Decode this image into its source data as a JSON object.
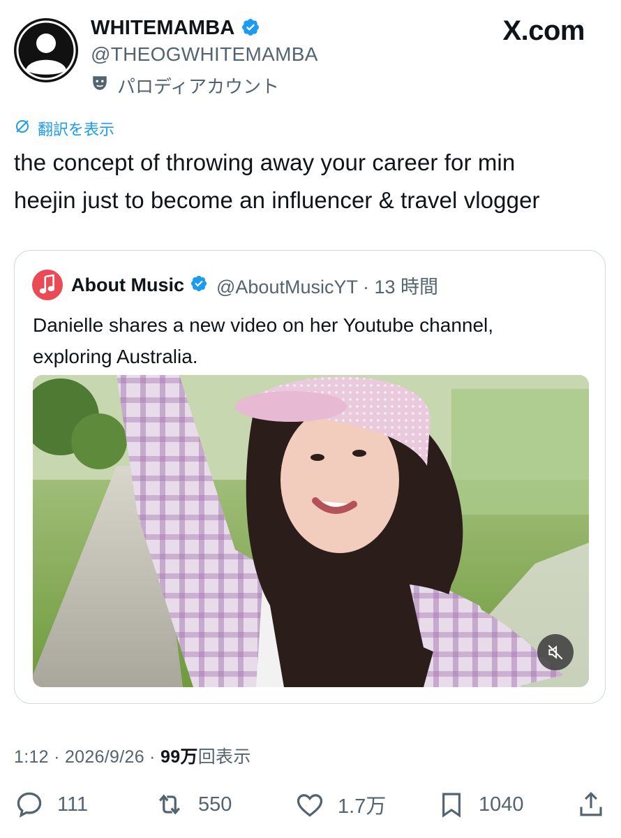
{
  "header": {
    "display_name": "WHITEMAMBA",
    "handle": "@THEOGWHITEMAMBA",
    "parody_label": "パロディアカウント",
    "site_label": "X.com"
  },
  "translate_label": "翻訳を表示",
  "tweet": {
    "line1": "the concept of throwing away your career for min",
    "line2": "heejin just to become an influencer & travel vlogger"
  },
  "quote": {
    "name": "About Music",
    "handle_time": "@AboutMusicYT · 13 時間",
    "text_line1": "Danielle shares a new video on her Youtube channel,",
    "text_line2": "exploring Australia."
  },
  "meta": {
    "time_date": "1:12 · 2026/9/26 · ",
    "views_count": "99万",
    "views_label": "回表示"
  },
  "actions": {
    "replies": "111",
    "reposts": "550",
    "likes": "1.7万",
    "bookmarks": "1040"
  },
  "colors": {
    "accent": "#1d9bf0",
    "text": "#0f1419",
    "secondary": "#536471",
    "border": "#cfd9de",
    "quote_avatar": "#ea4a55"
  },
  "icons": [
    "verified-badge-icon",
    "parody-mask-icon",
    "translate-icon",
    "music-note-icon",
    "mute-icon",
    "reply-icon",
    "repost-icon",
    "like-icon",
    "bookmark-icon",
    "share-icon"
  ]
}
